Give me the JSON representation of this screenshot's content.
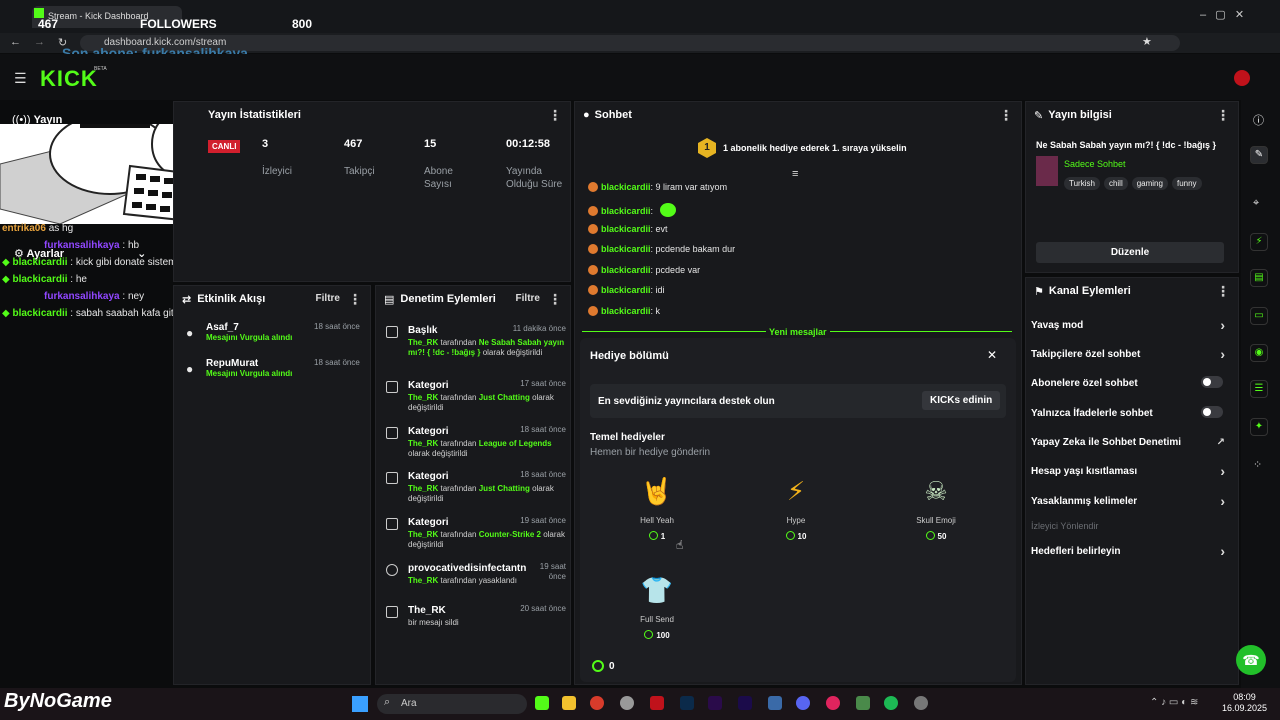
{
  "browser": {
    "tab_title": "Stream - Kick Dashboard",
    "url": "dashboard.kick.com/stream"
  },
  "overlay": {
    "count_left": "467",
    "followers_label": "FOLLOWERS",
    "count_right": "800",
    "last_sub": "Son abone: furkansalihkaya"
  },
  "kick": {
    "logo": "KICK",
    "beta": "BETA"
  },
  "nav": {
    "stream_label": "Yayın",
    "settings_label": "Ayarlar"
  },
  "stats": {
    "title": "Yayın İstatistikleri",
    "live_badge": "CANLI",
    "items": [
      {
        "value": "3",
        "label": "İzleyici"
      },
      {
        "value": "467",
        "label": "Takipçi"
      },
      {
        "value": "15",
        "label": "Abone Sayısı"
      },
      {
        "value": "00:12:58",
        "label": "Yayında Olduğu Süre"
      }
    ]
  },
  "activity": {
    "title": "Etkinlik Akışı",
    "filter": "Filtre",
    "items": [
      {
        "name": "Asaf_7",
        "desc": "Mesajını Vurgula alındı",
        "time": "18 saat önce"
      },
      {
        "name": "RepuMurat",
        "desc": "Mesajını Vurgula alındı",
        "time": "18 saat önce"
      }
    ]
  },
  "moderation": {
    "title": "Denetim Eylemleri",
    "filter": "Filtre",
    "items": [
      {
        "head": "Başlık",
        "time": "11 dakika önce",
        "user": "The_RK",
        "mid": "tarafından",
        "val": "Ne Sabah Sabah yayın mı?! { !dc - !bağış }",
        "tail": "olarak değiştirildi"
      },
      {
        "head": "Kategori",
        "time": "17 saat önce",
        "user": "The_RK",
        "mid": "tarafından",
        "val": "Just Chatting",
        "tail": "olarak değiştirildi"
      },
      {
        "head": "Kategori",
        "time": "18 saat önce",
        "user": "The_RK",
        "mid": "tarafından",
        "val": "League of Legends",
        "tail": "olarak değiştirildi"
      },
      {
        "head": "Kategori",
        "time": "18 saat önce",
        "user": "The_RK",
        "mid": "tarafından",
        "val": "Just Chatting",
        "tail": "olarak değiştirildi"
      },
      {
        "head": "Kategori",
        "time": "19 saat önce",
        "user": "The_RK",
        "mid": "tarafından",
        "val": "Counter-Strike 2",
        "tail": "olarak değiştirildi"
      },
      {
        "head": "provocativedisinfectantn",
        "time": "19 saat önce",
        "user": "The_RK",
        "mid": "tarafından yasaklandı",
        "val": "",
        "tail": ""
      },
      {
        "head": "The_RK",
        "time": "20 saat önce",
        "user": "",
        "mid": "bir mesajı sildi",
        "val": "",
        "tail": ""
      }
    ]
  },
  "chat": {
    "title": "Sohbet",
    "pinned": "1 abonelik hediye ederek 1. sıraya yükselin",
    "pin_rank": "1",
    "messages": [
      {
        "user": "blackicardii",
        "text": " 9 liram var atıyom"
      },
      {
        "user": "blackicardii",
        "text": " "
      },
      {
        "user": "blackicardii",
        "text": " evt"
      },
      {
        "user": "blackicardii",
        "text": " pcdende bakam dur"
      },
      {
        "user": "blackicardii",
        "text": " pcdede var"
      },
      {
        "user": "blackicardii",
        "text": " idi"
      },
      {
        "user": "blackicardii",
        "text": " k"
      }
    ],
    "new_messages": "Yeni mesajlar"
  },
  "gifts": {
    "title": "Hediye bölümü",
    "support_text": "En sevdiğiniz yayıncılara destek olun",
    "kicks_btn": "KICKs edinin",
    "basic_title": "Temel hediyeler",
    "basic_sub": "Hemen bir hediye gönderin",
    "items": [
      {
        "name": "Hell Yeah",
        "price": "1"
      },
      {
        "name": "Hype",
        "price": "10"
      },
      {
        "name": "Skull Emoji",
        "price": "50"
      },
      {
        "name": "Full Send",
        "price": "100"
      }
    ],
    "balance": "0"
  },
  "info": {
    "title": "Yayın bilgisi",
    "stream_title": "Ne Sabah Sabah yayın mı?! { !dc - !bağış }",
    "mode": "Sadece Sohbet",
    "tags": [
      "Turkish",
      "chill",
      "gaming",
      "funny"
    ],
    "edit_btn": "Düzenle"
  },
  "actions": {
    "title": "Kanal Eylemleri",
    "items": [
      {
        "label": "Yavaş mod",
        "kind": "chev"
      },
      {
        "label": "Takipçilere özel sohbet",
        "kind": "chev"
      },
      {
        "label": "Abonelere özel sohbet",
        "kind": "toggle"
      },
      {
        "label": "Yalnızca İfadelerle sohbet",
        "kind": "toggle"
      },
      {
        "label": "Yapay Zeka ile Sohbet Denetimi",
        "kind": "ext"
      },
      {
        "label": "Hesap yaşı kısıtlaması",
        "kind": "chev"
      },
      {
        "label": "Yasaklanmış kelimeler",
        "kind": "chev"
      }
    ],
    "section": "İzleyici Yönlendir",
    "goals": "Hedefleri belirleyin"
  },
  "leftchat": [
    {
      "user": "entrika06",
      "text": "as hg",
      "cls": "o"
    },
    {
      "user": "furkansalihkaya",
      "text": ": hb",
      "cls": "u1"
    },
    {
      "user": "blackicardii",
      "text": ": kick gibi donate sistemi varmı burda",
      "cls": "u2"
    },
    {
      "user": "blackicardii",
      "text": ": he",
      "cls": "u2"
    },
    {
      "user": "furkansalihkaya",
      "text": ": ney",
      "cls": "u1"
    },
    {
      "user": "blackicardii",
      "text": ": sabah saabah kafa gitti",
      "cls": "u2"
    }
  ],
  "taskbar": {
    "brand": "ByNoGame",
    "search": "Ara",
    "time": "08:09",
    "date": "16.09.2025"
  }
}
